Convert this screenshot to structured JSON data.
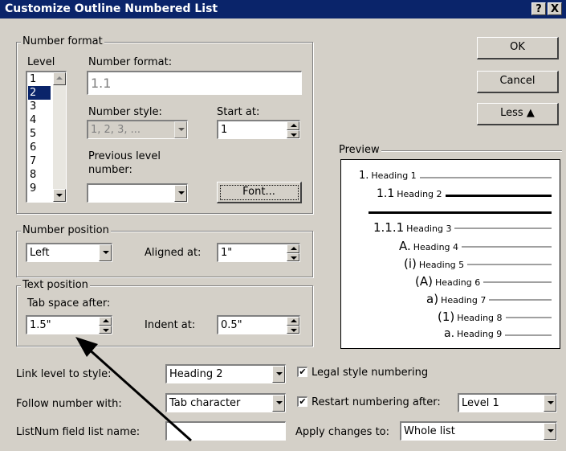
{
  "title": "Customize Outline Numbered List",
  "title_buttons": {
    "help": "?",
    "close": "X"
  },
  "number_format_group": {
    "legend": "Number format",
    "level_label": "Level",
    "levels": [
      "1",
      "2",
      "3",
      "4",
      "5",
      "6",
      "7",
      "8",
      "9"
    ],
    "selected_level": "2",
    "number_format_label": "Number format:",
    "number_format_value": "1.1",
    "number_style_label": "Number style:",
    "number_style_value": "1, 2, 3, ...",
    "start_at_label": "Start at:",
    "start_at_value": "1",
    "previous_level_label_1": "Previous level",
    "previous_level_label_2": "number:",
    "previous_level_value": "",
    "font_button": "Font..."
  },
  "buttons": {
    "ok": "OK",
    "cancel": "Cancel",
    "less": "Less ▲"
  },
  "preview": {
    "legend": "Preview",
    "items": [
      {
        "num": "1.",
        "text": "Heading 1"
      },
      {
        "num": "1.1",
        "text": "Heading 2"
      },
      {
        "num": "1.1.1",
        "text": "Heading 3"
      },
      {
        "num": "A.",
        "text": "Heading 4"
      },
      {
        "num": "(i)",
        "text": "Heading 5"
      },
      {
        "num": "(A)",
        "text": "Heading 6"
      },
      {
        "num": "a)",
        "text": "Heading 7"
      },
      {
        "num": "(1)",
        "text": "Heading 8"
      },
      {
        "num": "a.",
        "text": "Heading 9"
      }
    ]
  },
  "number_position_group": {
    "legend": "Number position",
    "alignment_value": "Left",
    "aligned_at_label": "Aligned at:",
    "aligned_at_value": "1\""
  },
  "text_position_group": {
    "legend": "Text position",
    "tab_space_label": "Tab space after:",
    "tab_space_value": "1.5\"",
    "indent_at_label": "Indent at:",
    "indent_at_value": "0.5\""
  },
  "bottom": {
    "link_level_label": "Link level to style:",
    "link_level_value": "Heading 2",
    "follow_label": "Follow number with:",
    "follow_value": "Tab character",
    "listnum_label": "ListNum field list name:",
    "listnum_value": "",
    "legal_label": "Legal style numbering",
    "legal_checked": true,
    "restart_label": "Restart numbering after:",
    "restart_checked": true,
    "restart_value": "Level 1",
    "apply_label": "Apply changes to:",
    "apply_value": "Whole list"
  }
}
